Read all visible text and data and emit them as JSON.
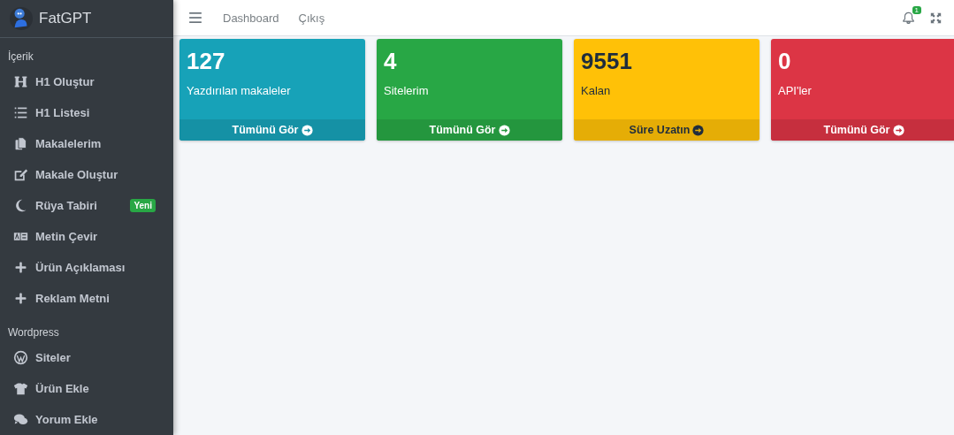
{
  "brand": {
    "name": "FatGPT"
  },
  "sidebar": {
    "sections": [
      {
        "title": "İçerik",
        "items": [
          {
            "label": "H1 Oluştur",
            "kind": "heading"
          },
          {
            "label": "H1 Listesi",
            "kind": "list"
          },
          {
            "label": "Makalelerim",
            "kind": "copy"
          },
          {
            "label": "Makale Oluştur",
            "kind": "edit"
          },
          {
            "label": "Rüya Tabiri",
            "kind": "moon",
            "badge": "Yeni"
          },
          {
            "label": "Metin Çevir",
            "kind": "language"
          },
          {
            "label": "Ürün Açıklaması",
            "kind": "plus"
          },
          {
            "label": "Reklam Metni",
            "kind": "plus"
          }
        ]
      },
      {
        "title": "Wordpress",
        "items": [
          {
            "label": "Siteler",
            "kind": "wordpress"
          },
          {
            "label": "Ürün Ekle",
            "kind": "shirt"
          },
          {
            "label": "Yorum Ekle",
            "kind": "comments"
          }
        ]
      }
    ]
  },
  "navbar": {
    "links": [
      "Dashboard",
      "Çıkış"
    ],
    "notification_count": "1"
  },
  "cards": [
    {
      "value": "127",
      "label": "Yazdırılan makaleler",
      "footer": "Tümünü Gör",
      "kind": "info"
    },
    {
      "value": "4",
      "label": "Sitelerim",
      "footer": "Tümünü Gör",
      "kind": "success"
    },
    {
      "value": "9551",
      "label": "Kalan",
      "footer": "Süre Uzatın",
      "kind": "warning"
    },
    {
      "value": "0",
      "label": "API'ler",
      "footer": "Tümünü Gör",
      "kind": "danger"
    }
  ]
}
